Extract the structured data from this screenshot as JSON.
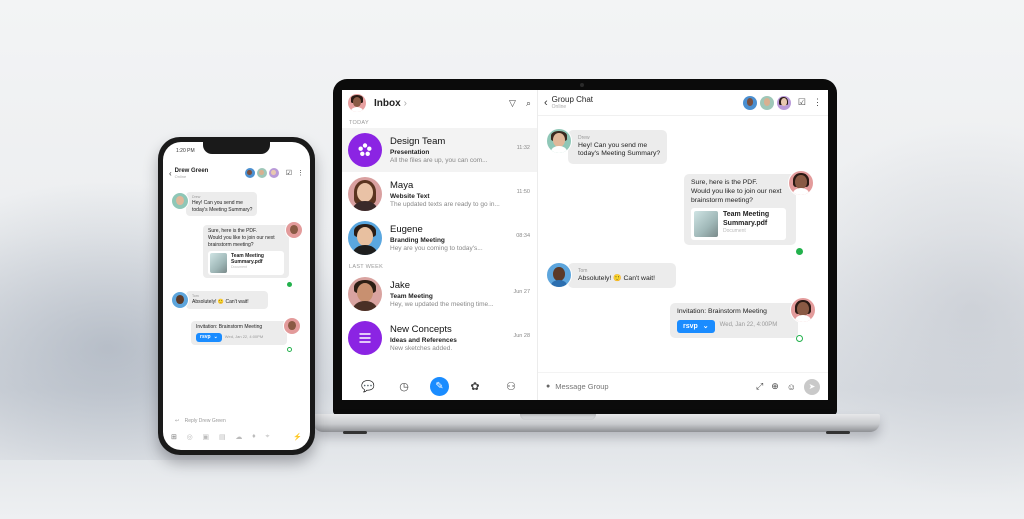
{
  "colors": {
    "accent_blue": "#1a8cff",
    "purple": "#8b24e3",
    "bubble_gray": "#ececec",
    "online_green": "#22b14c"
  },
  "laptop": {
    "inbox": {
      "title": "Inbox",
      "header_icons": [
        "filter-icon",
        "search-icon"
      ],
      "sections": [
        {
          "label": "TODAY",
          "conversations": [
            {
              "name": "Design Team",
              "subject": "Presentation",
              "preview": "All the files are up, you can com...",
              "time": "11:32",
              "avatar": "group-flower-icon",
              "active": true
            },
            {
              "name": "Maya",
              "subject": "Website Text",
              "preview": "The updated texts are ready to go in...",
              "time": "11:50",
              "avatar": "photo"
            },
            {
              "name": "Eugene",
              "subject": "Branding Meeting",
              "preview": "Hey are you coming to today's...",
              "time": "08:34",
              "avatar": "photo"
            }
          ]
        },
        {
          "label": "LAST WEEK",
          "conversations": [
            {
              "name": "Jake",
              "subject": "Team Meeting",
              "preview": "Hey, we updated the meeting time...",
              "time": "Jun 27",
              "avatar": "photo"
            },
            {
              "name": "New Concepts",
              "subject": "Ideas and References",
              "preview": "New sketches added.",
              "time": "Jun 28",
              "avatar": "list-icon"
            }
          ]
        }
      ],
      "footer_nav": [
        "chat-icon",
        "history-icon",
        "compose-icon",
        "apps-icon",
        "contacts-icon"
      ]
    },
    "chat": {
      "title": "Group Chat",
      "status": "Online",
      "messages": [
        {
          "sender": "Drew",
          "text_lines": [
            "Hey! Can you send me",
            "today's Meeting Summary?"
          ],
          "direction": "in"
        },
        {
          "sender": "",
          "text_lines": [
            "Sure, here is the PDF.",
            "Would you like to join our next",
            "brainstorm meeting?"
          ],
          "direction": "out",
          "attachment": {
            "title_lines": [
              "Team Meeting",
              "Summary.pdf"
            ],
            "type": "Document"
          }
        },
        {
          "sender": "Tom",
          "text": "Absolutely!",
          "emoji": "🙂",
          "text_after": "Can't wait!",
          "direction": "in"
        },
        {
          "sender": "",
          "text": "Invitation: Brainstorm Meeting",
          "direction": "out",
          "rsvp": {
            "label": "rsvp",
            "date": "Wed, Jan 22, 4:00PM"
          }
        }
      ],
      "input_placeholder": "Message Group"
    }
  },
  "phone": {
    "time": "1:20 PM",
    "contact_name": "Drew Green",
    "contact_status": "Online",
    "reply_placeholder": "Reply Drew Green",
    "tool_icons": [
      "add-icon",
      "camera-icon",
      "image-icon",
      "file-icon",
      "cloud-icon",
      "mic-icon",
      "location-icon",
      "bolt-icon"
    ]
  }
}
